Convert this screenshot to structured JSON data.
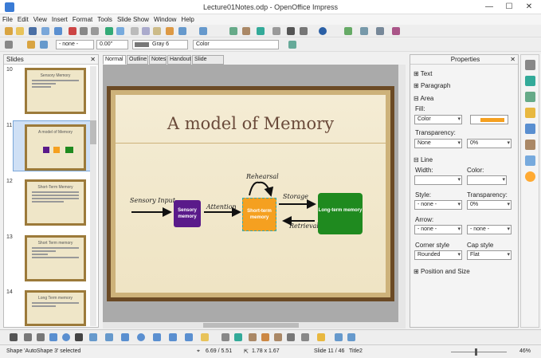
{
  "window": {
    "title": "Lecture01Notes.odp - OpenOffice Impress",
    "minimize": "—",
    "maximize": "☐",
    "close": "✕"
  },
  "menu": [
    "File",
    "Edit",
    "View",
    "Insert",
    "Format",
    "Tools",
    "Slide Show",
    "Window",
    "Help"
  ],
  "toolbar2": {
    "line_style": "- none -",
    "line_width": "0.00\"",
    "area_color": "Gray 6",
    "area_style": "Color"
  },
  "slides_panel": {
    "title": "Slides",
    "close": "✕",
    "thumbnails": [
      {
        "num": "10",
        "title": "Sensory Memory"
      },
      {
        "num": "11",
        "title": "A model of Memory"
      },
      {
        "num": "12",
        "title": "Short-Term Memory"
      },
      {
        "num": "13",
        "title": "Short Term memory"
      },
      {
        "num": "14",
        "title": "Long Term memory"
      }
    ]
  },
  "view_tabs": [
    "Normal",
    "Outline",
    "Notes",
    "Handout",
    "Slide Sorter"
  ],
  "slide": {
    "title": "A model of Memory",
    "sensory_input": "Sensory Input",
    "sensory_memory": "Sensory memory",
    "attention": "Attention",
    "short_term": "Short-term memory",
    "rehearsal": "Rehearsal",
    "storage": "Storage",
    "retrieval": "Retrieval",
    "long_term": "Long-term memory"
  },
  "properties": {
    "title": "Properties",
    "close": "✕",
    "text_section": "Text",
    "paragraph_section": "Paragraph",
    "area_section": "Area",
    "fill_label": "Fill:",
    "fill_value": "Color",
    "transparency_label": "Transparency:",
    "transparency_value": "None",
    "transparency_pct": "0%",
    "line_section": "Line",
    "width_label": "Width:",
    "color_label": "Color:",
    "style_label": "Style:",
    "style_value": "- none -",
    "line_transparency_label": "Transparency:",
    "line_transparency_value": "0%",
    "arrow_label": "Arrow:",
    "arrow_left": "- none -",
    "arrow_right": "- none -",
    "corner_label": "Corner style",
    "corner_value": "Rounded",
    "cap_label": "Cap style",
    "cap_value": "Flat",
    "position_section": "Position and Size"
  },
  "status": {
    "message": "Shape 'AutoShape 3' selected",
    "position": "6.69 / 5.51",
    "size": "1.78 x 1.67",
    "slide_info": "Slide 11 / 46",
    "layout": "Title2",
    "zoom": "46%"
  },
  "colors": {
    "accent_selected": "#cfe0f5",
    "frame_brown": "#6b4a25",
    "purple": "#5a1a8a",
    "orange": "#f5a020",
    "green": "#1f8a1f"
  }
}
